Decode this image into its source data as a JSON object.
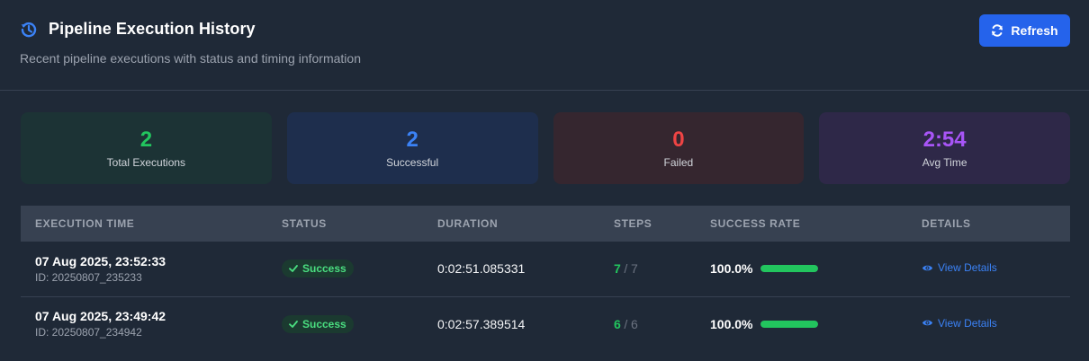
{
  "header": {
    "title": "Pipeline Execution History",
    "subtitle": "Recent pipeline executions with status and timing information",
    "title_icon": "history-icon",
    "refresh_label": "Refresh",
    "refresh_icon": "refresh-icon"
  },
  "stats": [
    {
      "value": "2",
      "label": "Total Executions",
      "color": "#22c55e"
    },
    {
      "value": "2",
      "label": "Successful",
      "color": "#3b82f6"
    },
    {
      "value": "0",
      "label": "Failed",
      "color": "#ef4444"
    },
    {
      "value": "2:54",
      "label": "Avg Time",
      "color": "#a855f7"
    }
  ],
  "table": {
    "columns": [
      "EXECUTION TIME",
      "STATUS",
      "DURATION",
      "STEPS",
      "SUCCESS RATE",
      "DETAILS"
    ],
    "rows": [
      {
        "time": "07 Aug 2025, 23:52:33",
        "id": "ID: 20250807_235233",
        "status": "Success",
        "duration": "0:02:51.085331",
        "steps_done": "7",
        "steps_sep": "/",
        "steps_total": "7",
        "rate": "100.0%",
        "rate_fraction": 1.0,
        "details": "View Details"
      },
      {
        "time": "07 Aug 2025, 23:49:42",
        "id": "ID: 20250807_234942",
        "status": "Success",
        "duration": "0:02:57.389514",
        "steps_done": "6",
        "steps_sep": "/",
        "steps_total": "6",
        "rate": "100.0%",
        "rate_fraction": 1.0,
        "details": "View Details"
      }
    ]
  },
  "colors": {
    "accent": "#2563eb",
    "success": "#22c55e",
    "link": "#3b82f6",
    "background": "#1f2937"
  }
}
